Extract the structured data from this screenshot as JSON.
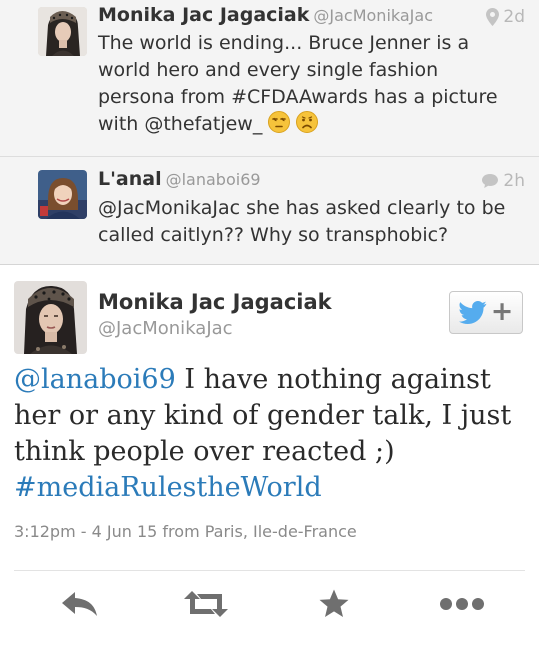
{
  "context_tweets": [
    {
      "name": "Monika Jac Jagaciak",
      "handle": "@JacMonikaJac",
      "time": "2d",
      "text": "The world is ending... Bruce Jenner is a world hero and every single fashion persona from #CFDAAwards has a picture with @thefatjew_",
      "emojis": [
        "unamused-face-icon",
        "frowning-face-icon"
      ]
    },
    {
      "name": "L'anal",
      "handle": "@lanaboi69",
      "time": "2h",
      "text": "@JacMonikaJac she has asked clearly to be called caitlyn?? Why so transphobic?"
    }
  ],
  "main_tweet": {
    "name": "Monika Jac Jagaciak",
    "handle": "@JacMonikaJac",
    "mention": "@lanaboi69",
    "text": " I have nothing against her or any kind of gender talk, I just think people over reacted ;) ",
    "hashtag": "#mediaRulestheWorld",
    "meta": "3:12pm - 4 Jun 15 from Paris, Ile-de-France"
  },
  "follow_button": {
    "plus": "+"
  },
  "actions": [
    "reply-icon",
    "retweet-icon",
    "favorite-icon",
    "more-icon"
  ],
  "colors": {
    "link": "#2b7bb9",
    "twitter_blue": "#55acee",
    "context_bg": "#f4f4f4",
    "icon_grey": "#6f6f6f",
    "emoji_yellow": "#f6c33b"
  }
}
